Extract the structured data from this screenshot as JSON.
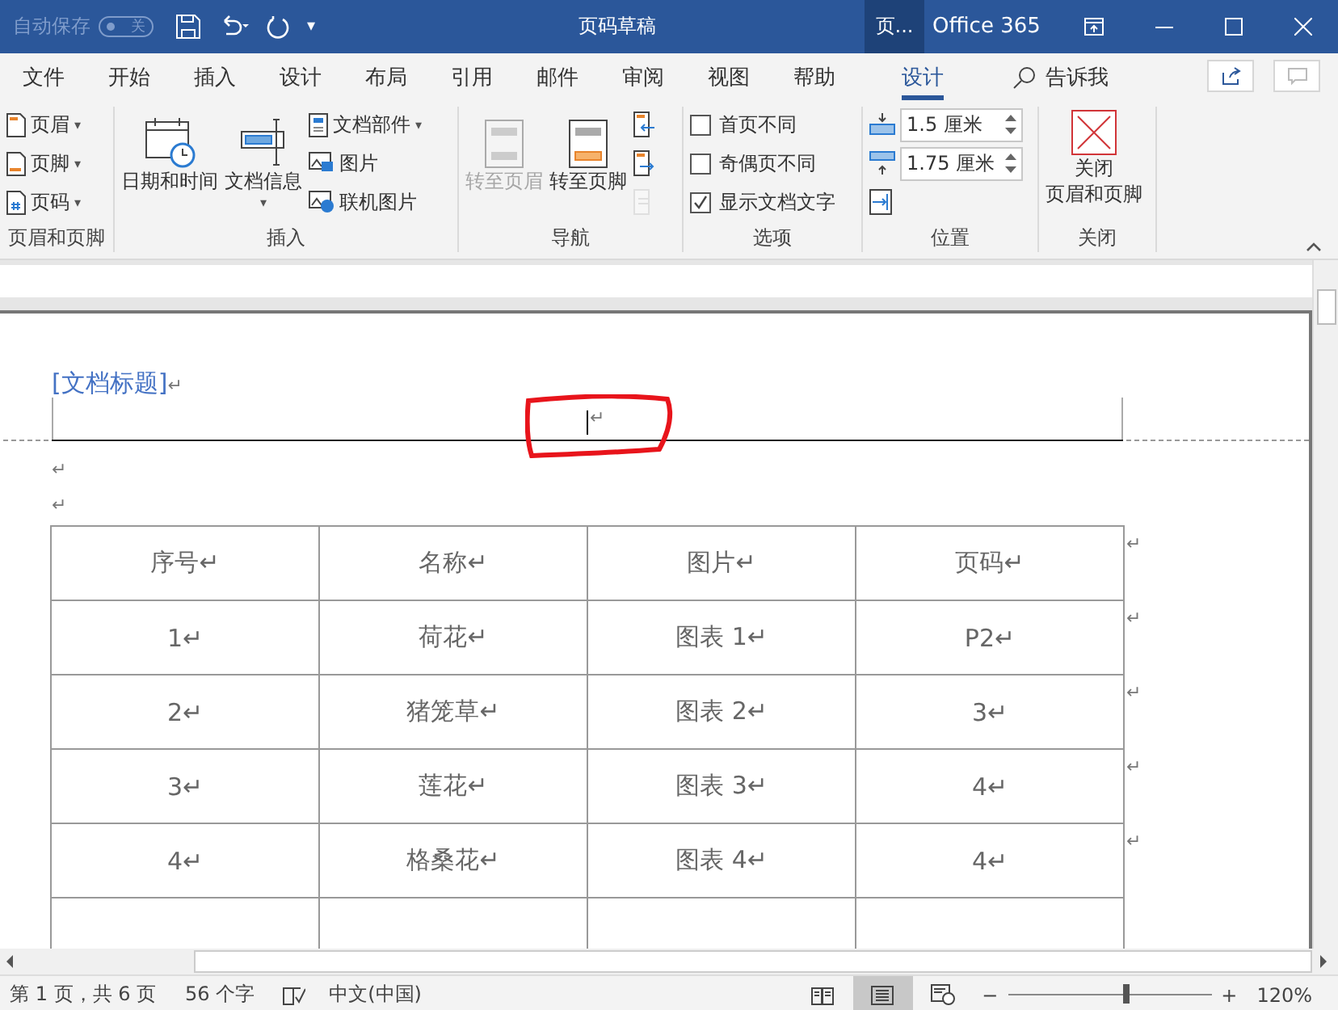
{
  "titlebar": {
    "autosave": {
      "label": "自动保存",
      "on": false,
      "state_text": "关"
    },
    "customize": "▾",
    "title": "页码草稿",
    "context_tab": "页...",
    "account": "Office 365"
  },
  "tabs": [
    {
      "label": "文件",
      "selected": false
    },
    {
      "label": "开始",
      "selected": false
    },
    {
      "label": "插入",
      "selected": false
    },
    {
      "label": "设计",
      "selected": false
    },
    {
      "label": "布局",
      "selected": false
    },
    {
      "label": "引用",
      "selected": false
    },
    {
      "label": "邮件",
      "selected": false
    },
    {
      "label": "审阅",
      "selected": false
    },
    {
      "label": "视图",
      "selected": false
    },
    {
      "label": "帮助",
      "selected": false
    },
    {
      "label": "设计",
      "selected": true
    }
  ],
  "tell_me": "告诉我",
  "ribbon": {
    "groups": [
      {
        "name": "页眉和页脚",
        "items": [
          {
            "kind": "small",
            "label": "页眉",
            "caret": "▾"
          },
          {
            "kind": "small",
            "label": "页脚",
            "caret": "▾"
          },
          {
            "kind": "small",
            "label": "页码",
            "caret": "▾"
          }
        ]
      },
      {
        "name": "插入",
        "items": [
          {
            "kind": "large",
            "label": "日期和时间",
            "disabled": false
          },
          {
            "kind": "large",
            "label": "文档信息",
            "caret": "▾",
            "disabled": false
          },
          {
            "kind": "small",
            "label": "文档部件",
            "caret": "▾"
          },
          {
            "kind": "small",
            "label": "图片"
          },
          {
            "kind": "small",
            "label": "联机图片"
          }
        ]
      },
      {
        "name": "导航",
        "items": [
          {
            "kind": "large",
            "label": "转至页眉",
            "disabled": true
          },
          {
            "kind": "large",
            "label": "转至页脚",
            "disabled": false
          },
          {
            "kind": "tiny",
            "disabled": false
          },
          {
            "kind": "tiny",
            "disabled": false
          },
          {
            "kind": "tiny",
            "disabled": true
          }
        ]
      },
      {
        "name": "选项",
        "items": [
          {
            "kind": "check",
            "label": "首页不同",
            "checked": false
          },
          {
            "kind": "check",
            "label": "奇偶页不同",
            "checked": false
          },
          {
            "kind": "check",
            "label": "显示文档文字",
            "checked": true
          }
        ]
      },
      {
        "name": "位置",
        "items": [
          {
            "kind": "spin",
            "value": "1.5 厘米"
          },
          {
            "kind": "spin",
            "value": "1.75 厘米"
          },
          {
            "kind": "tiny",
            "disabled": false
          }
        ]
      },
      {
        "name": "关闭",
        "items": [
          {
            "kind": "close",
            "label_lines": [
              "关闭",
              "页眉和页脚"
            ]
          }
        ]
      }
    ]
  },
  "document": {
    "header_title": "[文档标题]",
    "header_title_mark": "↵",
    "header_mark": "↵",
    "body_marks": [
      "↵",
      "↵"
    ],
    "table": {
      "rows": [
        {
          "cells": [
            "序号↵",
            "名称↵",
            "图片↵",
            "页码↵"
          ],
          "end_mark": "↵"
        },
        {
          "cells": [
            "1↵",
            "荷花↵",
            "图表 1↵",
            "P2↵"
          ],
          "end_mark": "↵"
        },
        {
          "cells": [
            "2↵",
            "猪笼草↵",
            "图表 2↵",
            "3↵"
          ],
          "end_mark": "↵"
        },
        {
          "cells": [
            "3↵",
            "莲花↵",
            "图表 3↵",
            "4↵"
          ],
          "end_mark": "↵"
        },
        {
          "cells": [
            "4↵",
            "格桑花↵",
            "图表 4↵",
            "4↵"
          ],
          "end_mark": "↵"
        }
      ]
    }
  },
  "status_bar": {
    "page": "第 1 页，共 6 页",
    "words": "56 个字",
    "language": "中文(中国)",
    "views": [
      {
        "selected": false
      },
      {
        "selected": true
      },
      {
        "selected": false
      }
    ],
    "zoom_out": "−",
    "zoom_in": "+",
    "zoom": {
      "level": 0.58
    },
    "zoom_text": "120%"
  }
}
